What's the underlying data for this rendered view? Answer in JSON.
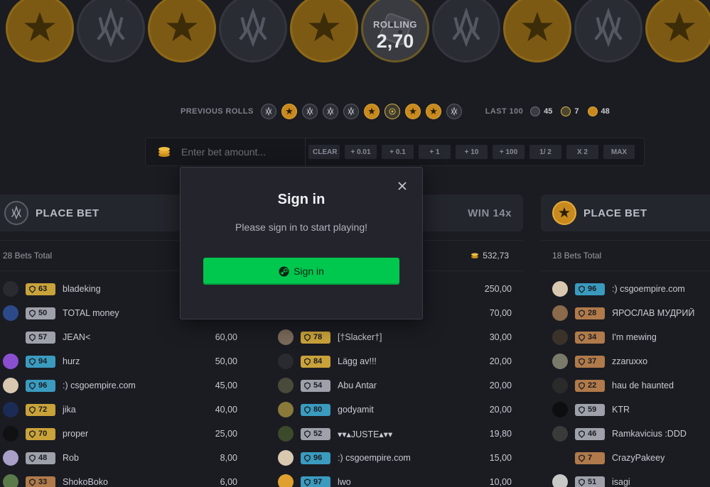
{
  "roll": {
    "label": "ROLLING",
    "value": "2,70",
    "strip": [
      "t",
      "ct",
      "t",
      "ct",
      "t",
      "bonus-slot",
      "ct",
      "t",
      "ct",
      "t"
    ]
  },
  "previous_rolls": {
    "label": "PREVIOUS ROLLS",
    "items": [
      "ct",
      "t",
      "ct",
      "ct",
      "ct",
      "t",
      "bonus",
      "t",
      "t",
      "ct"
    ],
    "last100_label": "LAST 100",
    "counts": {
      "ct": "45",
      "bonus": "7",
      "t": "48"
    }
  },
  "bet_bar": {
    "placeholder": "Enter bet amount...",
    "buttons": [
      "CLEAR",
      "+ 0.01",
      "+ 0.1",
      "+ 1",
      "+ 10",
      "+ 100",
      "1/ 2",
      "X 2",
      "MAX"
    ]
  },
  "columns": {
    "left": {
      "title": "PLACE BET",
      "total_label": "28 Bets Total",
      "rows": [
        {
          "level": "63",
          "tier": "gold",
          "name": "bladeking",
          "amount": "",
          "avatar": "#2a2b30"
        },
        {
          "level": "50",
          "tier": "silver",
          "name": "TOTAL money",
          "amount": "",
          "avatar": "#2c4a8a"
        },
        {
          "level": "57",
          "tier": "silver",
          "name": "JEAN<",
          "amount": "60,00",
          "avatar": ""
        },
        {
          "level": "94",
          "tier": "blue",
          "name": "hurz",
          "amount": "50,00",
          "avatar": "#8a4fd0"
        },
        {
          "level": "96",
          "tier": "blue",
          "name": ":) csgoempire.com",
          "amount": "45,00",
          "avatar": "#d9c8b0"
        },
        {
          "level": "72",
          "tier": "gold",
          "name": "jika",
          "amount": "40,00",
          "avatar": "#1a2c55"
        },
        {
          "level": "70",
          "tier": "gold",
          "name": "proper",
          "amount": "25,00",
          "avatar": "#111114"
        },
        {
          "level": "48",
          "tier": "silver",
          "name": "Rob",
          "amount": "8,00",
          "avatar": "#a8a0c8"
        },
        {
          "level": "33",
          "tier": "bronze",
          "name": "ShokoBoko",
          "amount": "6,00",
          "avatar": "#5a7a4a"
        }
      ]
    },
    "middle": {
      "win_label": "WIN 14x",
      "total_amount": "532,73",
      "rows": [
        {
          "level": "",
          "tier": "",
          "name": "",
          "amount": "250,00",
          "avatar": ""
        },
        {
          "level": "",
          "tier": "",
          "name": "",
          "amount": "70,00",
          "avatar": ""
        },
        {
          "level": "78",
          "tier": "gold",
          "name": "[†Slacker†]",
          "amount": "30,00",
          "avatar": "#7a6a5a"
        },
        {
          "level": "84",
          "tier": "gold",
          "name": "Lägg av!!!",
          "amount": "20,00",
          "avatar": "#2a2b30"
        },
        {
          "level": "54",
          "tier": "silver",
          "name": "Abu Antar",
          "amount": "20,00",
          "avatar": "#4a4a3a"
        },
        {
          "level": "80",
          "tier": "blue",
          "name": "godyamit",
          "amount": "20,00",
          "avatar": "#8a7a3a"
        },
        {
          "level": "52",
          "tier": "silver",
          "name": "▾▾▴JUSTE▴▾▾",
          "amount": "19,80",
          "avatar": "#3a4a2a"
        },
        {
          "level": "96",
          "tier": "blue",
          "name": ":) csgoempire.com",
          "amount": "15,00",
          "avatar": "#d9c8b0"
        },
        {
          "level": "97",
          "tier": "blue",
          "name": "lwo",
          "amount": "10,00",
          "avatar": "#e0a030"
        }
      ]
    },
    "right": {
      "title": "PLACE BET",
      "total_label": "18 Bets Total",
      "rows": [
        {
          "level": "96",
          "tier": "blue",
          "name": ":) csgoempire.com",
          "amount": "",
          "avatar": "#d9c8b0"
        },
        {
          "level": "28",
          "tier": "bronze",
          "name": "ЯРОСЛАВ МУДРИЙ",
          "amount": "",
          "avatar": "#8a6a4a"
        },
        {
          "level": "34",
          "tier": "bronze",
          "name": "I'm mewing",
          "amount": "",
          "avatar": "#3a3228"
        },
        {
          "level": "37",
          "tier": "bronze",
          "name": "zzaruxxo",
          "amount": "",
          "avatar": "#7a7a6a"
        },
        {
          "level": "22",
          "tier": "bronze",
          "name": "hau de haunted",
          "amount": "",
          "avatar": "#2a2a2a"
        },
        {
          "level": "59",
          "tier": "silver",
          "name": "KTR",
          "amount": "",
          "avatar": "#0e0e10"
        },
        {
          "level": "46",
          "tier": "silver",
          "name": "Ramkavicius :DDD",
          "amount": "",
          "avatar": "#3a3a3a"
        },
        {
          "level": "7",
          "tier": "bronze",
          "name": "CrazyPakeey",
          "amount": "",
          "avatar": ""
        },
        {
          "level": "51",
          "tier": "silver",
          "name": "isagi",
          "amount": "",
          "avatar": "#c8c8c8"
        }
      ]
    }
  },
  "modal": {
    "title": "Sign in",
    "subtitle": "Please sign in to start playing!",
    "button_label": "Sign in"
  },
  "colors": {
    "background": "#1b1c22",
    "panel": "#24262d",
    "accent_green": "#00c74d",
    "t_gold": "#c88a1e",
    "level_gold": "#c9a23a",
    "level_silver": "#9ea1aa",
    "level_blue": "#3a9bbf",
    "level_bronze": "#b07a4a"
  },
  "icons": {
    "ct_emblem": "ct-wings-icon",
    "t_emblem": "t-star-knives-icon",
    "bonus_emblem": "bonus-dice-icon",
    "close": "close-icon",
    "steam": "steam-icon",
    "coins": "coins-icon",
    "level": "level-shield-icon"
  }
}
